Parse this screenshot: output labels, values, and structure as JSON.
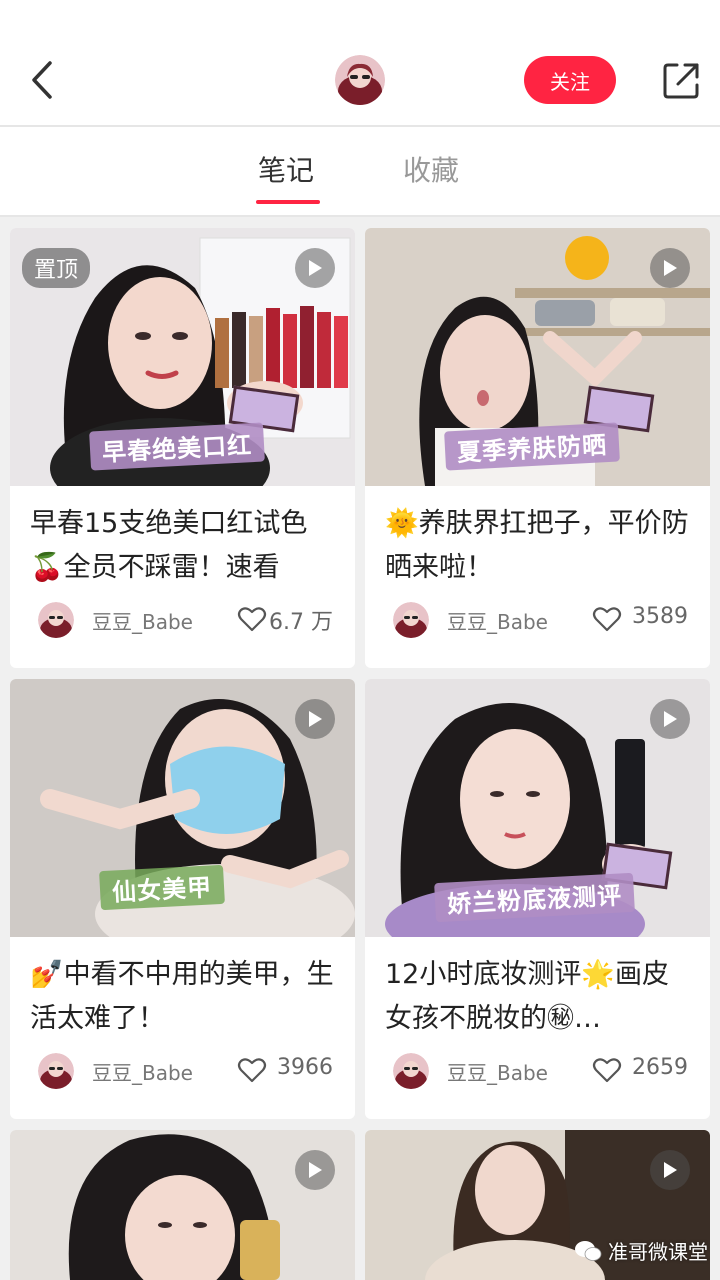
{
  "header": {
    "follow_label": "关注",
    "icons": [
      "chevron-left-icon",
      "avatar",
      "share-icon"
    ]
  },
  "tabs": [
    {
      "label": "笔记",
      "active": true
    },
    {
      "label": "收藏",
      "active": false
    }
  ],
  "notes": [
    {
      "pinned_label": "置顶",
      "image_caption": "早春绝美口红",
      "title": "早春15支绝美口红试色🍒全员不踩雷！速看",
      "author": "豆豆_Babe",
      "likes": "6.7 万"
    },
    {
      "image_caption": "夏季养肤防晒",
      "title": "🌞养肤界扛把子，平价防晒来啦！",
      "author": "豆豆_Babe",
      "likes": "3589"
    },
    {
      "image_caption": "仙女美甲",
      "title": "💅中看不中用的美甲，生活太难了！",
      "author": "豆豆_Babe",
      "likes": "3966"
    },
    {
      "image_caption": "娇兰粉底液测评",
      "title": "12小时底妆测评🌟画皮女孩不脱妆的㊙…",
      "author": "豆豆_Babe",
      "likes": "2659"
    }
  ],
  "watermark": "准哥微课堂",
  "colors": {
    "accent": "#ff2442",
    "background": "#f0f0f0"
  }
}
